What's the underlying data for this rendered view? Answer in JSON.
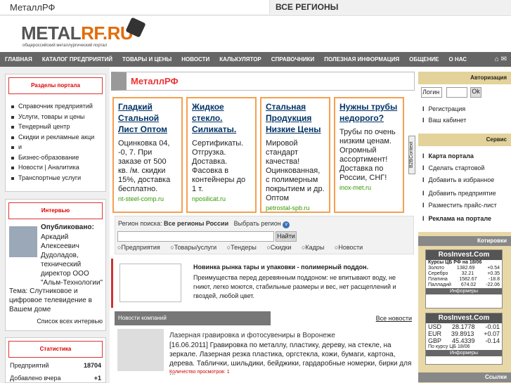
{
  "topbar": {
    "site": "МеталлРФ",
    "region": "ВСЕ РЕГИОНЫ"
  },
  "logo": {
    "word_a": "METAL",
    "word_b": "RF.RU",
    "tagline": "общероссийский металлургический портал"
  },
  "nav": [
    "ГЛАВНАЯ",
    "КАТАЛОГ ПРЕДПРИЯТИЙ",
    "ТОВАРЫ И ЦЕНЫ",
    "НОВОСТИ",
    "КАЛЬКУЛЯТОР",
    "СПРАВОЧНИКИ",
    "ПОЛЕЗНАЯ ИНФОРМАЦИЯ",
    "ОБЩЕНИЕ",
    "О НАС"
  ],
  "sections": {
    "title": "Разделы портала",
    "items": [
      "Справочник предприятий",
      "Услуги, товары и цены",
      "Тендерный центр",
      "Скидки и рекламные акци",
      "и",
      "Бизнес-образование",
      "Новости | Аналитика",
      "Транспортные услуги"
    ]
  },
  "interview": {
    "title": "Интервью",
    "heading": "Опубликовано:",
    "text": "Аркадий Алексеевич Дудоладов, технический директор ООО \"Альм-Технологии\"",
    "theme": "Тема: Слутниковое и цифровое телевидение в Вашем доме",
    "all": "Список всех интервью"
  },
  "stats": {
    "title": "Статистика",
    "rows": [
      {
        "label": "Предприятий",
        "value": "18704"
      },
      {
        "label": "Добавлено вчера",
        "value": "+1"
      }
    ]
  },
  "main": {
    "title": "МеталлРФ"
  },
  "ads": [
    {
      "title": "Гладкий Стальной Лист Оптом",
      "desc": "Оцинковка 04, -0, 7. При заказе от 500 кв. /м. скидки 15%, доставка бесплатно.",
      "url": "nt-steel-comp.ru"
    },
    {
      "title": "Жидкое стекло. Силикаты.",
      "desc": "Сертификаты. Отгрузка. Доставка. Фасовка в контейнеры до 1 т.",
      "url": "nposilicat.ru"
    },
    {
      "title": "Стальная Продукция Низкие Цены",
      "desc": "Мировой стандарт качества! Оцинкованная, с полимерным покрытием и др. Оптом",
      "url": "petrostal-spb.ru"
    },
    {
      "title": "Нужны трубы недорого?",
      "desc": "Трубы по очень низким ценам. Огромный ассортимент! Доставка по России, СНГ!",
      "url": "inox-met.ru"
    }
  ],
  "search": {
    "label": "Регион поиска:",
    "region": "Все регионы России",
    "choose": "Выбрать регион",
    "button": "Найти",
    "options": [
      "Предприятия",
      "Товары/услуги",
      "Тендеры",
      "Скидки",
      "Кадры",
      "Новости"
    ]
  },
  "news1": {
    "title": "Новинка рынка тары и упаковки - полимерный поддон.",
    "text": "Преимущества перед деревянным поддоном: не впитывают воду, не гниют, легко моются, стабильные размеры и вес, нет расщеплений и гвоздей, любой цвет."
  },
  "company_news": {
    "title": "Новости компаний",
    "all": "Все новости",
    "item_title": "Лазерная гравировка и фотосувениры в Воронеже",
    "item_text": "[16.06.2011]    Гравировка по металлу, пластику, дереву, на стекле, на зеркале. Лазерная резка пластика, оргстекла, кожи, бумаги, картона, дерева. Таблички, шильдики, бейджики, гардаробные номерки, бирки для ...",
    "views": "Количество просмотров: 1"
  },
  "auth": {
    "title": "Авторизация",
    "login": "Логин",
    "ok": "Ok",
    "links": [
      "Регистрация",
      "Ваш кабинет"
    ]
  },
  "service": {
    "title": "Сервис",
    "links": [
      "Карта портала",
      "Сделать стартовой",
      "Добавить в избранное",
      "Добавить предприятие",
      "Разместить прайс-лист",
      "Реклама на портале"
    ]
  },
  "quotes": {
    "title": "Котировки",
    "w1": {
      "brand": "RosInvest.Com",
      "head": "Курсы ЦБ РФ на  18/06",
      "rows": [
        [
          "Золото",
          "1382.69",
          "+0.54"
        ],
        [
          "Серебро",
          "32.21",
          "+0.35"
        ],
        [
          "Платина",
          "1582.67",
          "-18.8"
        ],
        [
          "Палладий",
          "674.02",
          "-22.06"
        ]
      ],
      "foot": "Информеры"
    },
    "w2": {
      "brand": "RosInvest.Com",
      "rows": [
        [
          "USD",
          "28.1778",
          "-0.01"
        ],
        [
          "EUR",
          "39.8913",
          "+0.07"
        ],
        [
          "GBP",
          "45.4339",
          "-0.14"
        ]
      ],
      "sub": "По курсу ЦБ  18/06",
      "foot": "Информеры"
    }
  },
  "links_title": "Ссылки",
  "side_label": "B2BContext"
}
